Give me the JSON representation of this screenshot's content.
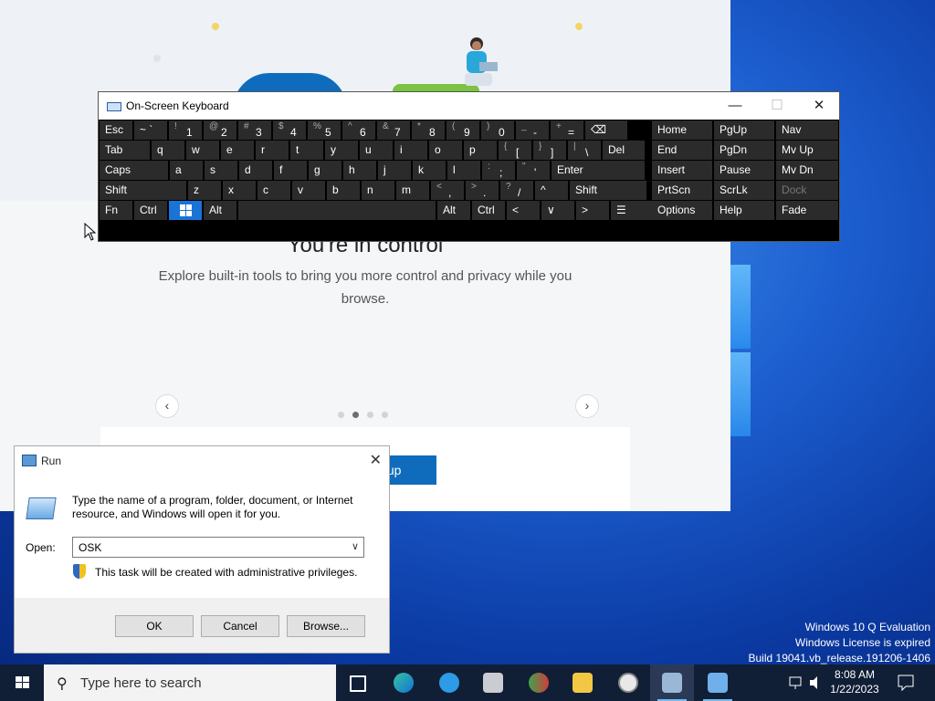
{
  "edge": {
    "heading": "You're in control",
    "subtitle": "Explore built-in tools to bring you more control and privacy while you browse.",
    "setup_button": "tup",
    "prev": "‹",
    "next": "›"
  },
  "osk": {
    "title": "On-Screen Keyboard",
    "minimize": "—",
    "maximize": "☐",
    "close": "✕",
    "row1": [
      [
        "Esc",
        ""
      ],
      [
        "~ `",
        ""
      ],
      [
        "1",
        "!"
      ],
      [
        "2",
        "@"
      ],
      [
        "3",
        "#"
      ],
      [
        "4",
        "$"
      ],
      [
        "5",
        "%"
      ],
      [
        "6",
        "^"
      ],
      [
        "7",
        "&"
      ],
      [
        "8",
        "*"
      ],
      [
        "9",
        "("
      ],
      [
        "0",
        ")"
      ],
      [
        "-",
        "_"
      ],
      [
        "=",
        "+"
      ],
      [
        "⌫",
        ""
      ]
    ],
    "row2": [
      [
        "Tab",
        ""
      ],
      [
        "q",
        ""
      ],
      [
        "w",
        ""
      ],
      [
        "e",
        ""
      ],
      [
        "r",
        ""
      ],
      [
        "t",
        ""
      ],
      [
        "y",
        ""
      ],
      [
        "u",
        ""
      ],
      [
        "i",
        ""
      ],
      [
        "o",
        ""
      ],
      [
        "p",
        ""
      ],
      [
        "[",
        "{"
      ],
      [
        "]",
        "}"
      ],
      [
        "\\",
        "|"
      ],
      [
        "Del",
        ""
      ]
    ],
    "row3": [
      [
        "Caps",
        ""
      ],
      [
        "a",
        ""
      ],
      [
        "s",
        ""
      ],
      [
        "d",
        ""
      ],
      [
        "f",
        ""
      ],
      [
        "g",
        ""
      ],
      [
        "h",
        ""
      ],
      [
        "j",
        ""
      ],
      [
        "k",
        ""
      ],
      [
        "l",
        ""
      ],
      [
        ";",
        ":"
      ],
      [
        "'",
        "\""
      ],
      [
        "Enter",
        ""
      ]
    ],
    "row4": [
      [
        "Shift",
        ""
      ],
      [
        "z",
        ""
      ],
      [
        "x",
        ""
      ],
      [
        "c",
        ""
      ],
      [
        "v",
        ""
      ],
      [
        "b",
        ""
      ],
      [
        "n",
        ""
      ],
      [
        "m",
        ""
      ],
      [
        ",",
        "<"
      ],
      [
        ".",
        ">"
      ],
      [
        "/",
        "?"
      ],
      [
        "^",
        ""
      ],
      [
        "Shift",
        ""
      ]
    ],
    "row5": [
      [
        "Fn",
        ""
      ],
      [
        "Ctrl",
        ""
      ],
      [
        "",
        ""
      ],
      [
        "Alt",
        ""
      ],
      [
        "",
        ""
      ],
      [
        "Alt",
        ""
      ],
      [
        "Ctrl",
        ""
      ],
      [
        "<",
        ""
      ],
      [
        "∨",
        ""
      ],
      [
        ">",
        ""
      ],
      [
        "☰",
        ""
      ]
    ],
    "nav": [
      [
        "Home",
        "PgUp",
        "Nav"
      ],
      [
        "End",
        "PgDn",
        "Mv Up"
      ],
      [
        "Insert",
        "Pause",
        "Mv Dn"
      ],
      [
        "PrtScn",
        "ScrLk",
        "Dock"
      ],
      [
        "Options",
        "Help",
        "Fade"
      ]
    ]
  },
  "run": {
    "title": "Run",
    "description": "Type the name of a program, folder, document, or Internet resource, and Windows will open it for you.",
    "open_label": "Open:",
    "open_value": "OSK",
    "admin_note": "This task will be created with administrative privileges.",
    "ok": "OK",
    "cancel": "Cancel",
    "browse": "Browse...",
    "close": "✕"
  },
  "taskbar": {
    "search_placeholder": "Type here to search",
    "apps": [
      "task-view",
      "edge",
      "app-blue",
      "printer",
      "users",
      "file-explorer",
      "clock-app",
      "osk",
      "run"
    ],
    "time": "8:08 AM",
    "date": "1/22/2023"
  },
  "watermark": {
    "line1": "Windows 10 Q Evaluation",
    "line2": "Windows License is expired",
    "line3": "Build 19041.vb_release.191206-1406"
  }
}
